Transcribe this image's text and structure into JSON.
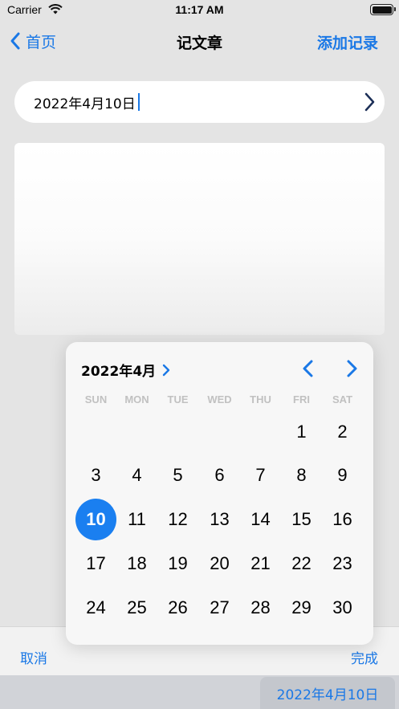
{
  "status_bar": {
    "carrier": "Carrier",
    "time": "11:17 AM"
  },
  "nav": {
    "back_label": "首页",
    "title": "记文章",
    "action_label": "添加记录"
  },
  "date_field": {
    "value": "2022年4月10日"
  },
  "toolbar": {
    "cancel_label": "取消",
    "done_label": "完成"
  },
  "bottom": {
    "date_label": "2022年4月10日"
  },
  "calendar": {
    "month_label": "2022年4月",
    "weekdays": [
      "SUN",
      "MON",
      "TUE",
      "WED",
      "THU",
      "FRI",
      "SAT"
    ],
    "days": [
      "1",
      "2",
      "3",
      "4",
      "5",
      "6",
      "7",
      "8",
      "9",
      "10",
      "11",
      "12",
      "13",
      "14",
      "15",
      "16",
      "17",
      "18",
      "19",
      "20",
      "21",
      "22",
      "23",
      "24",
      "25",
      "26",
      "27",
      "28",
      "29",
      "30"
    ],
    "first_weekday_index": 5,
    "selected_day": "10"
  },
  "colors": {
    "accent": "#1a78e6",
    "selected_bg": "#1a7ff0"
  },
  "icons": {
    "back": "chevron-left-icon",
    "field": "chevron-right-icon",
    "month": "chevron-right-icon",
    "prev": "chevron-left-icon",
    "next": "chevron-right-icon",
    "wifi": "wifi-icon",
    "battery": "battery-icon"
  }
}
